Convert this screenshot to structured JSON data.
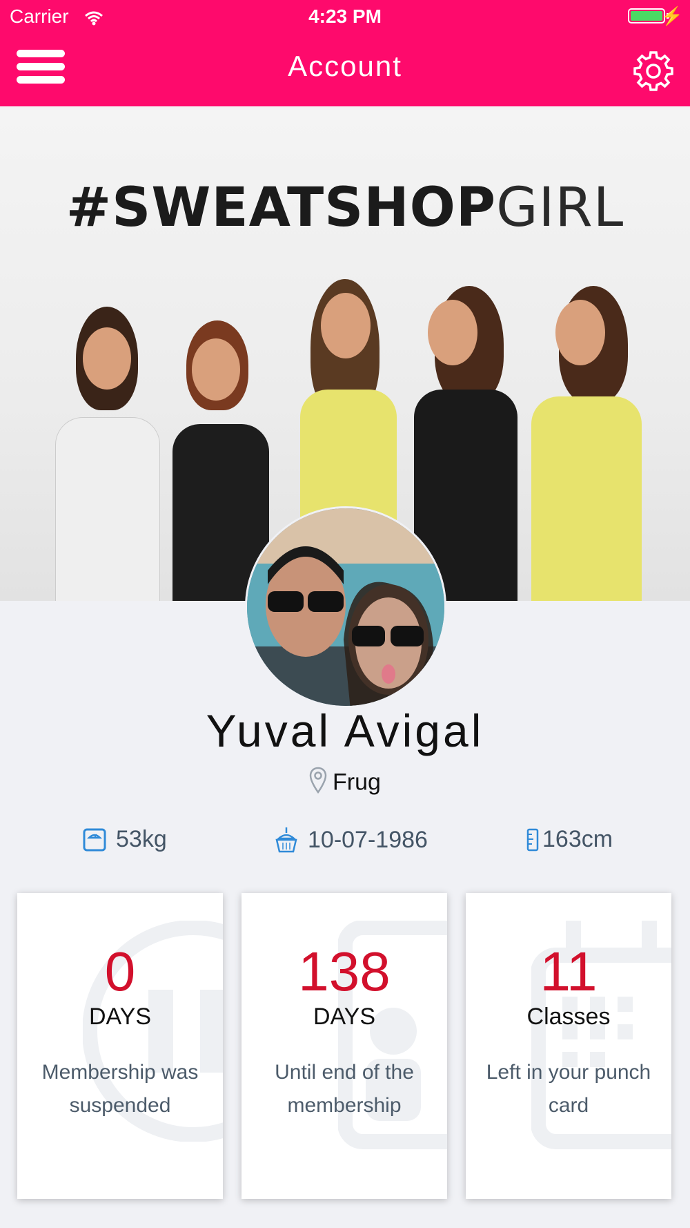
{
  "status_bar": {
    "carrier": "Carrier",
    "time": "4:23 PM"
  },
  "header": {
    "title": "Account",
    "menu_icon": "hamburger-menu-icon",
    "settings_icon": "gear-icon",
    "color": "#fe0a6c"
  },
  "hero": {
    "title_bold": "#SWEATSHOP",
    "title_light": "GIRL"
  },
  "profile": {
    "name": "Yuval Avigal",
    "location": "Frug",
    "weight": "53kg",
    "birthday": "10-07-1986",
    "height": "163cm"
  },
  "cards": [
    {
      "value": "0",
      "unit": "DAYS",
      "description": "Membership was suspended"
    },
    {
      "value": "138",
      "unit": "DAYS",
      "description": "Until end of the membership"
    },
    {
      "value": "11",
      "unit": "Classes",
      "description": "Left in your punch card"
    }
  ],
  "colors": {
    "accent": "#fe0a6c",
    "value_red": "#d2102c",
    "icon_blue": "#2f8ad8"
  }
}
